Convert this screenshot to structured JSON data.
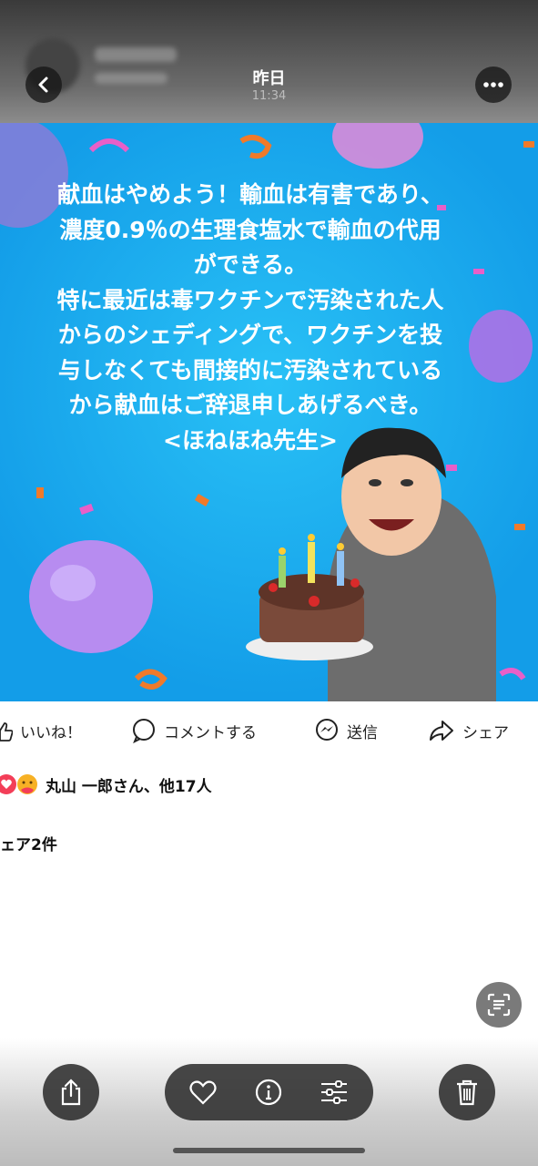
{
  "header": {
    "title": "昨日",
    "time": "11:34",
    "back_icon": "chevron-left-icon",
    "more_icon": "ellipsis-icon"
  },
  "post": {
    "text": "献血はやめよう！輸血は有害であり、\n濃度0.9％の生理食塩水で輸血の代用\nができる。\n特に最近は毒ワクチンで汚染された人\nからのシェディングで、ワクチンを投\n与しなくても間接的に汚染されている\nから献血はご辞退申しあげるべき。\n<ほねほね先生>",
    "background_color": "#1aa6ee"
  },
  "actions": [
    {
      "label": "いいね！",
      "icon": "thumbs-up-icon"
    },
    {
      "label": "コメントする",
      "icon": "comment-icon"
    },
    {
      "label": "送信",
      "icon": "messenger-icon"
    },
    {
      "label": "シェア",
      "icon": "share-arrow-icon"
    }
  ],
  "reactions": {
    "text": "丸山 一郎さん、他17人",
    "icons": [
      "heart-reaction-icon",
      "hug-reaction-icon"
    ]
  },
  "shares_text": "ェア2件",
  "toolbar": {
    "share_icon": "share-icon",
    "favorite_icon": "heart-icon",
    "info_icon": "info-icon",
    "adjust_icon": "sliders-icon",
    "delete_icon": "trash-icon",
    "scan_icon": "live-text-icon"
  }
}
